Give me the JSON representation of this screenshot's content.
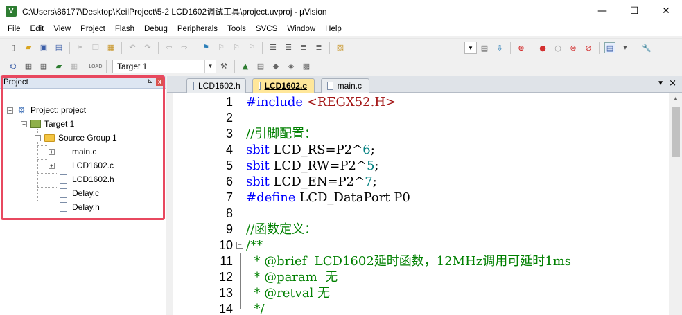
{
  "window": {
    "title": "C:\\Users\\86177\\Desktop\\KeilProject\\5-2 LCD1602调试工具\\project.uvproj - µVision",
    "minimize": "—",
    "maximize": "☐",
    "close": "✕"
  },
  "menu": [
    "File",
    "Edit",
    "View",
    "Project",
    "Flash",
    "Debug",
    "Peripherals",
    "Tools",
    "SVCS",
    "Window",
    "Help"
  ],
  "toolbar2": {
    "target_combo": "Target 1"
  },
  "project_panel": {
    "title": "Project",
    "pin": "⊾",
    "close": "x",
    "tree": {
      "project": "Project: project",
      "target": "Target 1",
      "group": "Source Group 1",
      "files": [
        "main.c",
        "LCD1602.c",
        "LCD1602.h",
        "Delay.c",
        "Delay.h"
      ]
    }
  },
  "editor": {
    "tabs": [
      {
        "label": "LCD1602.h",
        "active": false
      },
      {
        "label": "LCD1602.c",
        "active": true
      },
      {
        "label": "main.c",
        "active": false
      }
    ],
    "tab_arrow": "▼",
    "tab_close": "×",
    "lines": [
      {
        "n": "1",
        "parts": [
          [
            "pp",
            "#include "
          ],
          [
            "ang",
            "<REGX52.H>"
          ]
        ]
      },
      {
        "n": "2",
        "parts": []
      },
      {
        "n": "3",
        "parts": [
          [
            "cm",
            "//引脚配置："
          ]
        ]
      },
      {
        "n": "4",
        "parts": [
          [
            "kw",
            "sbit"
          ],
          [
            "pl",
            " LCD_RS=P2^"
          ],
          [
            "num",
            "6"
          ],
          [
            "pl",
            ";"
          ]
        ]
      },
      {
        "n": "5",
        "parts": [
          [
            "kw",
            "sbit"
          ],
          [
            "pl",
            " LCD_RW=P2^"
          ],
          [
            "num",
            "5"
          ],
          [
            "pl",
            ";"
          ]
        ]
      },
      {
        "n": "6",
        "parts": [
          [
            "kw",
            "sbit"
          ],
          [
            "pl",
            " LCD_EN=P2^"
          ],
          [
            "num",
            "7"
          ],
          [
            "pl",
            ";"
          ]
        ]
      },
      {
        "n": "7",
        "parts": [
          [
            "pp",
            "#define"
          ],
          [
            "pl",
            " LCD_DataPort P0"
          ]
        ]
      },
      {
        "n": "8",
        "parts": []
      },
      {
        "n": "9",
        "parts": [
          [
            "cm",
            "//函数定义："
          ]
        ]
      },
      {
        "n": "10",
        "parts": [
          [
            "cm",
            "/**"
          ]
        ]
      },
      {
        "n": "11",
        "parts": [
          [
            "cm",
            "  * @brief  LCD1602延时函数，12MHz调用可延时1ms"
          ]
        ]
      },
      {
        "n": "12",
        "parts": [
          [
            "cm",
            "  * @param  无"
          ]
        ]
      },
      {
        "n": "13",
        "parts": [
          [
            "cm",
            "  * @retval 无"
          ]
        ]
      },
      {
        "n": "14",
        "parts": [
          [
            "cm",
            "  */"
          ]
        ]
      }
    ]
  }
}
